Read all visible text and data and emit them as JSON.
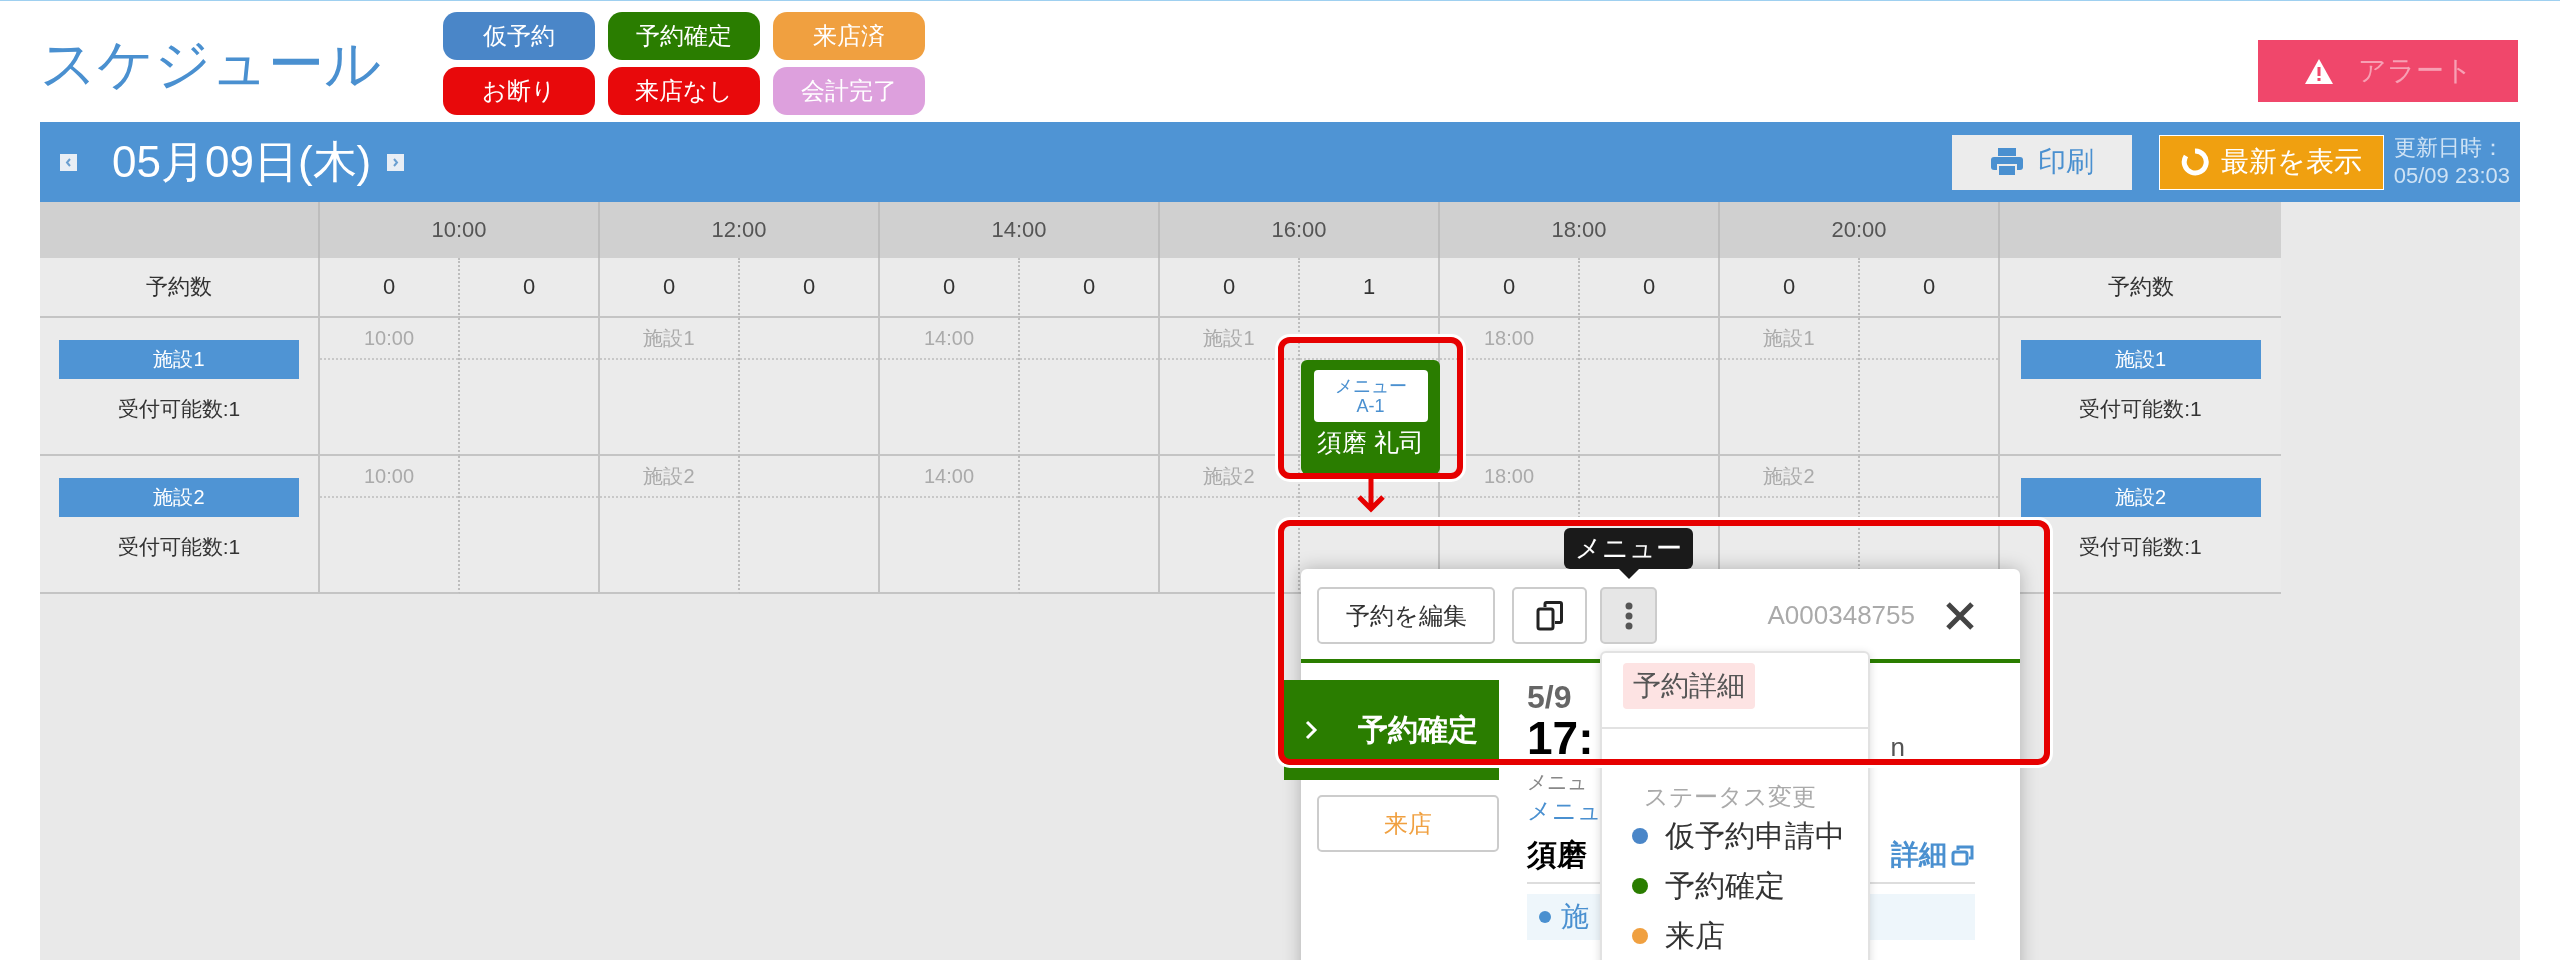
{
  "title": "スケジュール",
  "legend": [
    {
      "label": "仮予約",
      "color": "#4a86c8"
    },
    {
      "label": "予約確定",
      "color": "#2a7d00"
    },
    {
      "label": "来店済",
      "color": "#f0a040"
    },
    {
      "label": "お断り",
      "color": "#e8090b"
    },
    {
      "label": "来店なし",
      "color": "#e8090b"
    },
    {
      "label": "会計完了",
      "color": "#dda0dd"
    }
  ],
  "alert_button": {
    "label": "アラート",
    "disabled": true
  },
  "date_bar": {
    "date": "05月09日(木)",
    "print_button": "印刷",
    "refresh_button": "最新を表示",
    "updated_label": "更新日時：",
    "updated_at": "05/09 23:03"
  },
  "grid": {
    "times": [
      "10:00",
      "12:00",
      "14:00",
      "16:00",
      "18:00",
      "20:00"
    ],
    "count_label": "予約数",
    "count_label_right": "予約数",
    "counts": [
      "0",
      "0",
      "0",
      "0",
      "0",
      "0",
      "0",
      "1",
      "0",
      "0",
      "0",
      "0"
    ],
    "facilities": [
      {
        "name": "施設1",
        "capacity": "受付可能数:1",
        "slot_labels": [
          "10:00",
          "施設1",
          "14:00",
          "施設1",
          "18:00",
          "施設1"
        ],
        "name_right": "施設1",
        "capacity_right": "受付可能数:1"
      },
      {
        "name": "施設2",
        "capacity": "受付可能数:1",
        "slot_labels": [
          "10:00",
          "施設2",
          "14:00",
          "施設2",
          "18:00",
          "施設2"
        ],
        "name_right": "施設2",
        "capacity_right": "受付可能数:1"
      }
    ]
  },
  "booking": {
    "menu": "メニュー\nA-1",
    "customer": "須磨 礼司"
  },
  "popup": {
    "tooltip": "メニュー",
    "edit_button": "予約を編集",
    "menu_open": true,
    "reservation_id": "A000348755",
    "status": "予約確定",
    "visit_button": "来店",
    "date": "5/9",
    "time": "17:",
    "trailing": "n",
    "menu_label": "メニュ",
    "menu_link": "メニュ",
    "customer": "須磨",
    "detail_link": "詳細",
    "facility": "施"
  },
  "dropdown": {
    "items": [
      {
        "label": "予約詳細",
        "selected": true
      }
    ],
    "section": "ステータス変更",
    "statuses": [
      {
        "label": "仮予約申請中",
        "color": "#4a86c8"
      },
      {
        "label": "予約確定",
        "color": "#2a7d00"
      },
      {
        "label": "来店",
        "color": "#f0a040"
      }
    ]
  }
}
